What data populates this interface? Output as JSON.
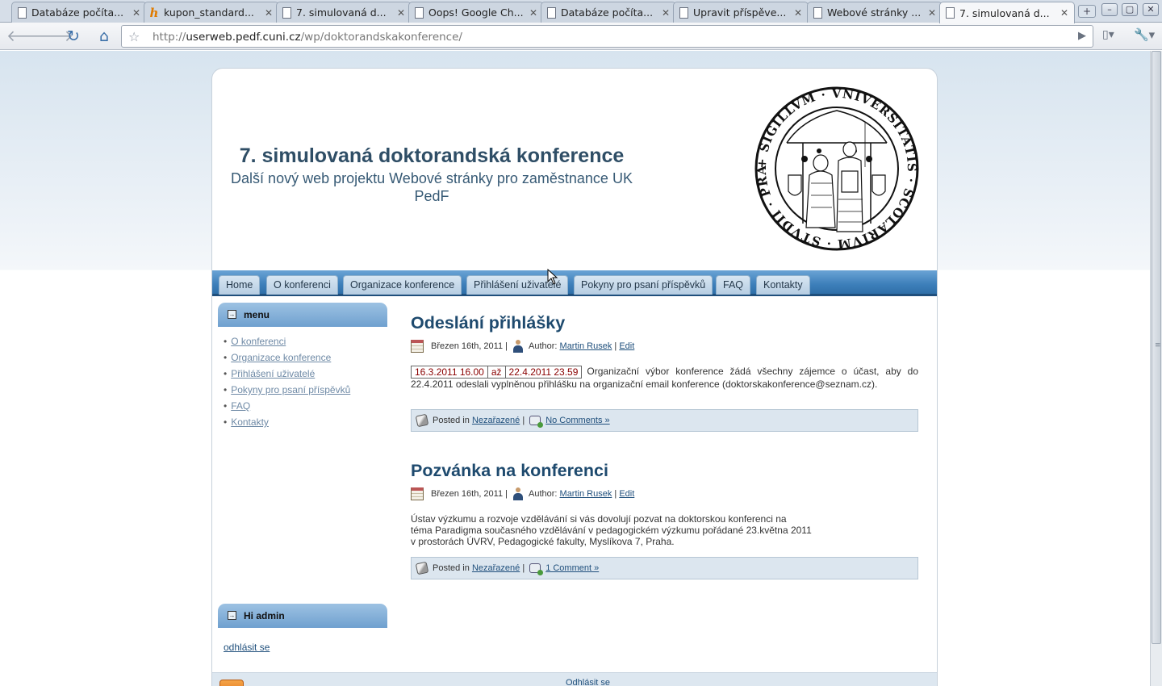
{
  "browser": {
    "tabs": [
      {
        "label": "Databáze počíta...",
        "icon": "page-icon"
      },
      {
        "label": "kupon_standard...",
        "icon": "h-favicon-icon"
      },
      {
        "label": "7. simulovaná d...",
        "icon": "page-icon"
      },
      {
        "label": "Oops! Google Ch...",
        "icon": "page-icon"
      },
      {
        "label": "Databáze počíta...",
        "icon": "page-icon"
      },
      {
        "label": "Upravit příspěve...",
        "icon": "page-icon"
      },
      {
        "label": "Webové stránky ...",
        "icon": "page-icon"
      },
      {
        "label": "7. simulovaná d...",
        "icon": "page-icon",
        "active": true
      }
    ],
    "url_prefix": "http://",
    "url_host": "userweb.pedf.cuni.cz",
    "url_path": "/wp/doktorandskakonference/"
  },
  "site": {
    "title": "7. simulovaná doktorandská konference",
    "description": "Další nový web projektu Webové stránky pro zaměstnance UK PedF"
  },
  "nav": [
    "Home",
    "O konferenci",
    "Organizace konference",
    "Přihlášení uživatelé",
    "Pokyny pro psaní příspěvků",
    "FAQ",
    "Kontakty"
  ],
  "sidebar": {
    "menu_title": "menu",
    "menu_items": [
      "O konferenci",
      "Organizace konference",
      "Přihlášení uživatelé",
      "Pokyny pro psaní příspěvků",
      "FAQ",
      "Kontakty"
    ],
    "admin_title": "Hi admin",
    "logout_label": "odhlásit se"
  },
  "posts": [
    {
      "title": "Odeslání přihlášky",
      "date": "Březen 16th, 2011 |",
      "author_label": "Author:",
      "author": "Martin Rusek",
      "edit": "Edit",
      "date_from": "16.3.2011 16.00",
      "date_sep": "až",
      "date_to": "22.4.2011 23.59",
      "body": "Organizační výbor konference žádá všechny zájemce o účast, aby do 22.4.2011 odeslali vyplněnou přihlášku na organizační email konference (doktorskakonference@seznam.cz).",
      "posted_in": "Posted in",
      "category": "Nezařazené",
      "comments": "No Comments »"
    },
    {
      "title": "Pozvánka na konferenci",
      "date": "Březen 16th, 2011 |",
      "author_label": "Author:",
      "author": "Martin Rusek",
      "edit": "Edit",
      "body_lines": [
        "Ústav výzkumu a rozvoje vzdělávání si vás dovolují pozvat na doktorskou konferenci na",
        "téma Paradigma současného vzdělávání v pedagogickém výzkumu pořádané 23.května 2011",
        "v prostorách ÚVRV, Pedagogické fakulty, Myslíkova 7, Praha."
      ],
      "posted_in": "Posted in",
      "category": "Nezařazené",
      "comments": "1 Comment »"
    }
  ],
  "footer": {
    "logout": "Odhlásit se"
  },
  "colors": {
    "accent": "#2f6fa8",
    "title": "#1e4a6e",
    "date_red": "#8a0000"
  }
}
